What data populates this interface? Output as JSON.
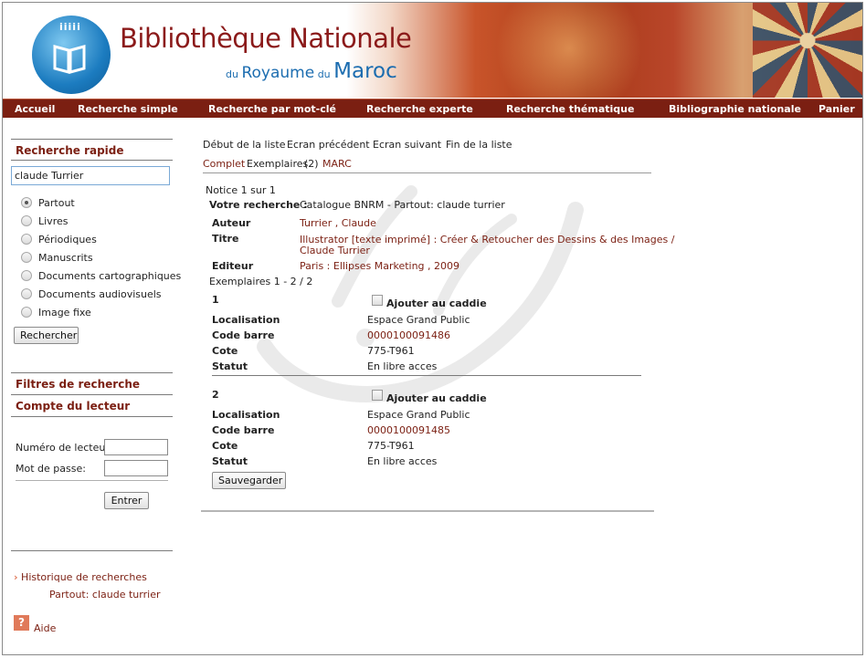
{
  "header": {
    "title_line1": "Bibliothèque Nationale",
    "title_du1": "du",
    "title_royaume": "Royaume",
    "title_du2": "du",
    "title_maroc": "Maroc",
    "logo_dots": "iiiii"
  },
  "nav": {
    "items": [
      "Accueil",
      "Recherche simple",
      "Recherche par mot-clé",
      "Recherche experte",
      "Recherche thématique",
      "Bibliographie nationale",
      "Panier"
    ]
  },
  "sidebar": {
    "quick_search_title": "Recherche rapide",
    "search_value": "claude Turrier",
    "radios": [
      "Partout",
      "Livres",
      "Périodiques",
      "Manuscrits",
      "Documents cartographiques",
      "Documents audiovisuels",
      "Image fixe"
    ],
    "selected_radio": "Partout",
    "search_button": "Rechercher",
    "filters_title": "Filtres de recherche",
    "account_title": "Compte du lecteur",
    "reader_number_label": "Numéro de lecteur:",
    "password_label": "Mot de passe:",
    "enter_button": "Entrer",
    "history_link": "Historique de recherches",
    "history_item": "Partout: claude turrier",
    "help_label": "Aide",
    "help_icon_text": "?"
  },
  "pager": {
    "first": "Début de la liste",
    "prev": "Ecran précédent",
    "next": "Ecran suivant",
    "last": "Fin de la liste"
  },
  "views": {
    "complet": "Complet",
    "exemplaires": "Exemplaires",
    "exemplaires_count": "(2)",
    "marc": "MARC"
  },
  "record": {
    "notice": "Notice 1 sur 1",
    "votre_recherche_label": "Votre recherche :",
    "votre_recherche_value": "Catalogue BNRM - Partout: claude turrier",
    "auteur_label": "Auteur",
    "auteur_value": "Turrier , Claude",
    "titre_label": "Titre",
    "titre_value_line1": "Illustrator [texte imprimé] : Créer & Retoucher des Dessins & des Images /",
    "titre_value_line2": "Claude Turrier",
    "editeur_label": "Editeur",
    "editeur_value": "Paris : Ellipses Marketing , 2009",
    "exemplaires_range": "Exemplaires 1 - 2 / 2"
  },
  "copies": [
    {
      "number": "1",
      "caddie_label": "Ajouter au caddie",
      "localisation_label": "Localisation",
      "localisation": "Espace Grand Public",
      "code_barre_label": "Code barre",
      "code_barre": "0000100091486",
      "cote_label": "Cote",
      "cote": "775-T961",
      "statut_label": "Statut",
      "statut": "En libre acces"
    },
    {
      "number": "2",
      "caddie_label": "Ajouter au caddie",
      "localisation_label": "Localisation",
      "localisation": "Espace Grand Public",
      "code_barre_label": "Code barre",
      "code_barre": "0000100091485",
      "cote_label": "Cote",
      "cote": "775-T961",
      "statut_label": "Statut",
      "statut": "En libre acces"
    }
  ],
  "save_button": "Sauvegarder",
  "colors": {
    "brand_red": "#7b1f12",
    "link": "#7b1f12",
    "brand_blue": "#1c6db0"
  }
}
